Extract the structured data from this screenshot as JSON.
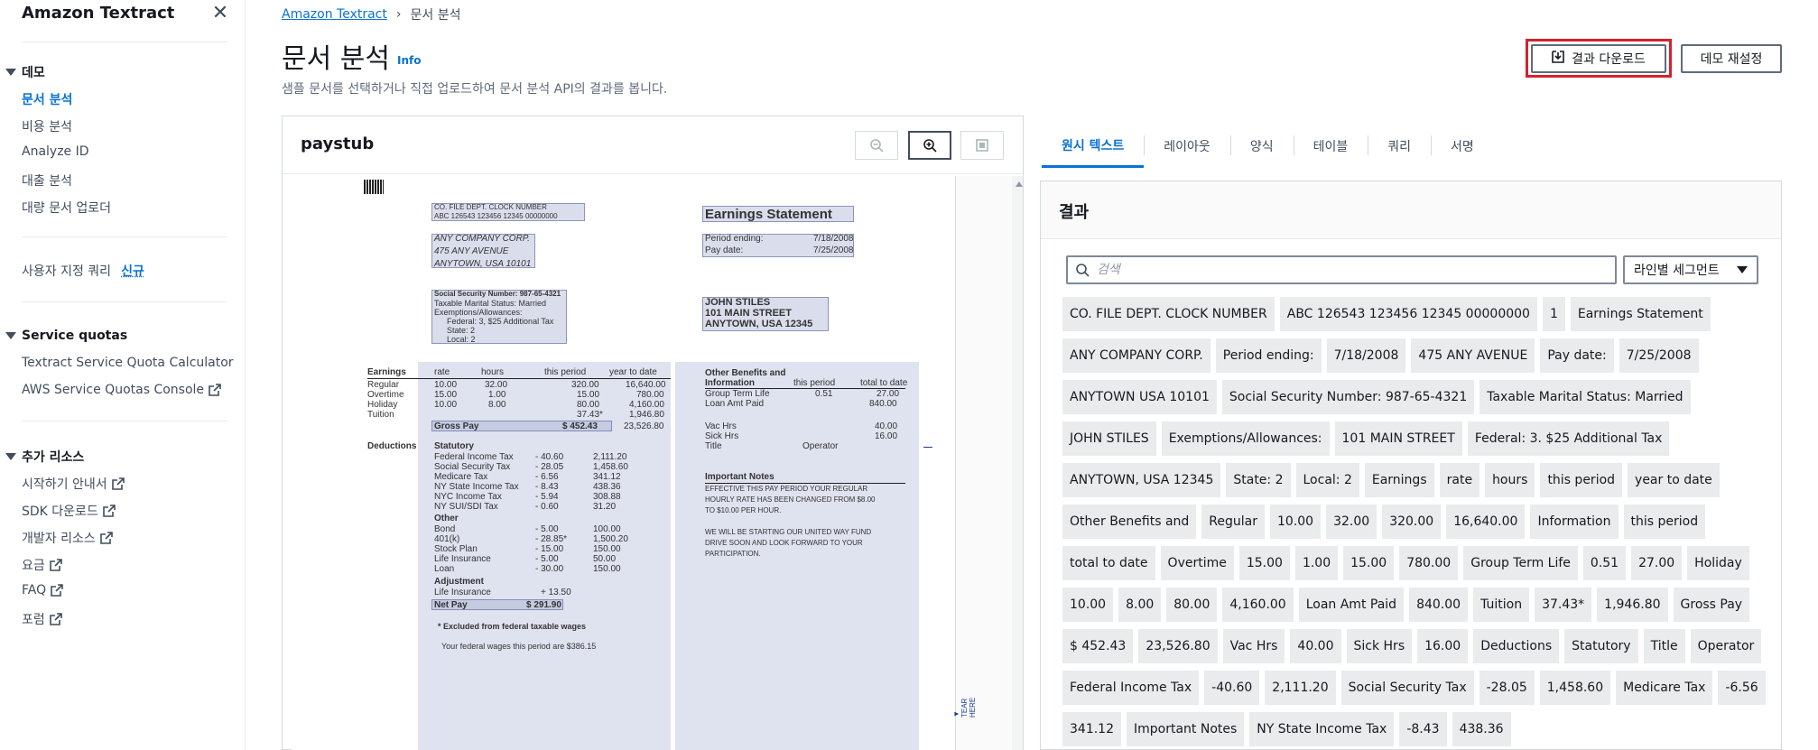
{
  "sidebar": {
    "title": "Amazon Textract",
    "sections": [
      {
        "label": "데모",
        "items": [
          {
            "label": "문서 분석",
            "active": true
          },
          {
            "label": "비용 분석"
          },
          {
            "label": "Analyze ID"
          },
          {
            "label": "대출 분석"
          },
          {
            "label": "대량 문서 업로더"
          }
        ]
      },
      {
        "label": "Service quotas",
        "items": [
          {
            "label": "Textract Service Quota Calculator"
          },
          {
            "label": "AWS Service Quotas Console",
            "external": true
          }
        ]
      },
      {
        "label": "추가 리소스",
        "items": [
          {
            "label": "시작하기 안내서",
            "external": true
          },
          {
            "label": "SDK 다운로드",
            "external": true
          },
          {
            "label": "개발자 리소스",
            "external": true
          },
          {
            "label": "요금",
            "external": true
          },
          {
            "label": "FAQ",
            "external": true
          },
          {
            "label": "포럼",
            "external": true
          }
        ]
      }
    ],
    "custom_query": {
      "label": "사용자 지정 쿼리",
      "badge": "신규"
    }
  },
  "breadcrumb": {
    "root": "Amazon Textract",
    "current": "문서 분석"
  },
  "header": {
    "title": "문서 분석",
    "info": "Info",
    "description": "샘플 문서를 선택하거나 직접 업로드하여 문서 분석 API의 결과를 봅니다.",
    "download_label": "결과 다운로드",
    "reset_label": "데모 재설정"
  },
  "doc_panel": {
    "title": "paystub"
  },
  "paystub": {
    "hdr": "CO.     FILE     DEPT.     CLOCK     NUMBER",
    "hdr_vals": "ABC   126543  123456  12345   00000000",
    "company": [
      "ANY COMPANY CORP.",
      "475 ANY AVENUE",
      "ANYTOWN, USA 10101"
    ],
    "statement": "Earnings Statement",
    "period_ending": "Period  ending:",
    "period_ending_val": "7/18/2008",
    "pay_date": "Pay  date:",
    "pay_date_val": "7/25/2008",
    "ssn": "Social Security Number: 987-65-4321",
    "marital": "Taxable Marital Status: Married",
    "exemptions": "Exemptions/Allowances:",
    "federal": "Federal:  3, $25  Additional  Tax",
    "state": "State:    2",
    "local": "Local:    2",
    "employee": [
      "JOHN STILES",
      "101 MAIN STREET",
      "ANYTOWN, USA 12345"
    ],
    "earnings_cols": [
      "Earnings",
      "rate",
      "hours",
      "this period",
      "year to date"
    ],
    "earnings_rows": [
      [
        "Regular",
        "10.00",
        "32.00",
        "320.00",
        "16,640.00"
      ],
      [
        "Overtime",
        "15.00",
        "1.00",
        "15.00",
        "780.00"
      ],
      [
        "Holiday",
        "10.00",
        "8.00",
        "80.00",
        "4,160.00"
      ],
      [
        "Tuition",
        "",
        "",
        "37.43*",
        "1,946.80"
      ]
    ],
    "gross_pay": "Gross Pay",
    "gross_pay_val": "$  452.43",
    "gross_pay_ytd": "23,526.80",
    "deductions": "Deductions",
    "statutory": "Statutory",
    "ded_rows": [
      [
        "Federal Income Tax",
        "- 40.60",
        "2,111.20"
      ],
      [
        "Social Security Tax",
        "- 28.05",
        "1,458.60"
      ],
      [
        "Medicare Tax",
        "- 6.56",
        "341.12"
      ],
      [
        "NY State Income Tax",
        "- 8.43",
        "438.36"
      ],
      [
        "NYC Income Tax",
        "- 5.94",
        "308.88"
      ],
      [
        "NY SUI/SDI Tax",
        "- 0.60",
        "31.20"
      ]
    ],
    "other": "Other",
    "other_rows": [
      [
        "Bond",
        "- 5.00",
        "100.00"
      ],
      [
        "401(k)",
        "- 28.85*",
        "1,500.20"
      ],
      [
        "Stock Plan",
        "- 15.00",
        "150.00"
      ],
      [
        "Life Insurance",
        "- 5.00",
        "50.00"
      ],
      [
        "Loan",
        "- 30.00",
        "150.00"
      ]
    ],
    "adjustment": "Adjustment",
    "adj_row": [
      "Life Insurance",
      "+ 13.50"
    ],
    "net_pay": "Net Pay",
    "net_pay_val": "$ 291.90",
    "excluded": "* Excluded  from  federal  taxable  wages",
    "fed_wages": "Your  federal  wages  this  period  are  $386.15",
    "ob_title1": "Other Benefits and",
    "ob_title2": "Information",
    "ob_cols": [
      "this period",
      "total to date"
    ],
    "ob_rows": [
      [
        "Group Term Life",
        "0.51",
        "27.00"
      ],
      [
        "Loan Amt Paid",
        "",
        "840.00"
      ]
    ],
    "vac": [
      "Vac  Hrs",
      "40.00"
    ],
    "sick": [
      "Sick  Hrs",
      "16.00"
    ],
    "title_row": [
      "Title",
      "Operator"
    ],
    "notes_title": "Important  Notes",
    "notes": [
      "EFFECTIVE THIS PAY PERIOD YOUR REGULAR",
      "HOURLY RATE HAS BEEN CHANGED FROM $8.00",
      "TO $10.00 PER HOUR.",
      "WE WILL BE STARTING OUR UNITED WAY FUND",
      "DRIVE SOON AND LOOK FORWARD TO YOUR",
      "PARTICIPATION."
    ],
    "tear": "▼ TEAR HERE"
  },
  "tabs": [
    "원시 텍스트",
    "레이아웃",
    "양식",
    "테이블",
    "쿼리",
    "서명"
  ],
  "results": {
    "title": "결과",
    "search_placeholder": "검색",
    "segment_select": "라인별 세그먼트",
    "chips": [
      "CO. FILE DEPT. CLOCK NUMBER",
      "ABC 126543 123456 12345 00000000",
      "1",
      "Earnings Statement",
      "ANY COMPANY CORP.",
      "Period ending:",
      "7/18/2008",
      "475 ANY AVENUE",
      "Pay date:",
      "7/25/2008",
      "ANYTOWN USA 10101",
      "Social Security Number: 987-65-4321",
      "Taxable Marital Status: Married",
      "JOHN STILES",
      "Exemptions/Allowances:",
      "101 MAIN STREET",
      "Federal: 3. $25 Additional Tax",
      "ANYTOWN, USA 12345",
      "State: 2",
      "Local: 2",
      "Earnings",
      "rate",
      "hours",
      "this period",
      "year to date",
      "Other Benefits and",
      "Regular",
      "10.00",
      "32.00",
      "320.00",
      "16,640.00",
      "Information",
      "this period",
      "total to date",
      "Overtime",
      "15.00",
      "1.00",
      "15.00",
      "780.00",
      "Group Term Life",
      "0.51",
      "27.00",
      "Holiday",
      "10.00",
      "8.00",
      "80.00",
      "4,160.00",
      "Loan Amt Paid",
      "840.00",
      "Tuition",
      "37.43*",
      "1,946.80",
      "Gross Pay",
      "$ 452.43",
      "23,526.80",
      "Vac Hrs",
      "40.00",
      "Sick Hrs",
      "16.00",
      "Deductions",
      "Statutory",
      "Title",
      "Operator",
      "Federal Income Tax",
      "-40.60",
      "2,111.20",
      "Social Security Tax",
      "-28.05",
      "1,458.60",
      "Medicare Tax",
      "-6.56",
      "341.12",
      "Important Notes",
      "NY State Income Tax",
      "-8.43",
      "438.36"
    ]
  }
}
